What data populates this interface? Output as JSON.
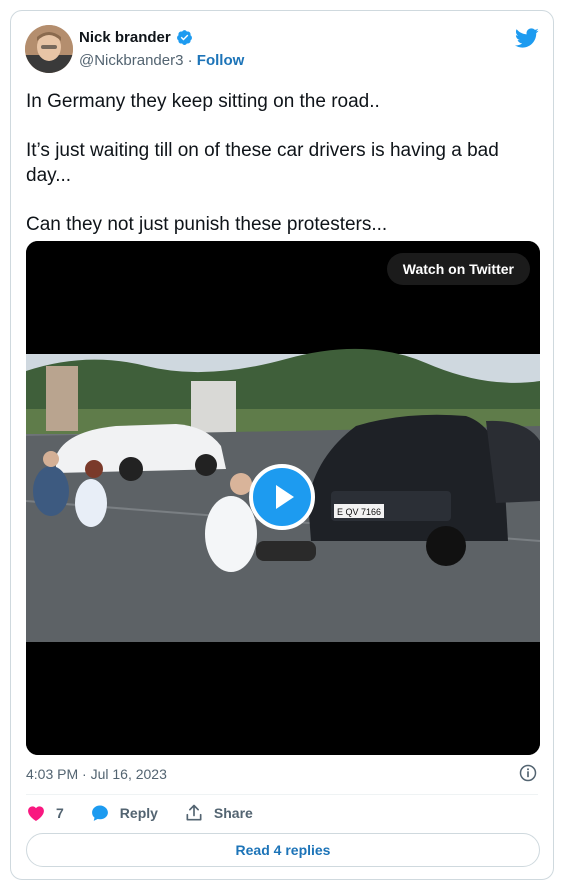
{
  "author": {
    "name": "Nick brander",
    "handle": "@Nickbrander3",
    "separator": "·",
    "follow_label": "Follow"
  },
  "tweet": {
    "lines": [
      "In Germany they keep sitting on the road..",
      "It’s just waiting till on of these car drivers is having a bad day...",
      "Can they not just punish these protesters..."
    ]
  },
  "media": {
    "watch_label": "Watch on Twitter",
    "plate_text": "E QV 7166"
  },
  "meta": {
    "timestamp": "4:03 PM · Jul 16, 2023"
  },
  "actions": {
    "like_count": "7",
    "reply_label": "Reply",
    "share_label": "Share"
  },
  "footer": {
    "read_replies_label": "Read 4 replies"
  },
  "colors": {
    "accent": "#1d9bf0",
    "like": "#f91880",
    "link": "#1d74b8"
  }
}
